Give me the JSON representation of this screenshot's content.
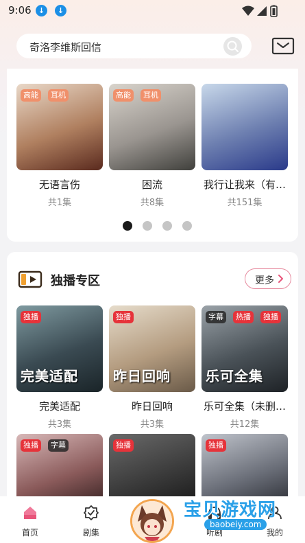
{
  "status_bar": {
    "time": "9:06"
  },
  "search": {
    "text": "奇洛李维斯回信"
  },
  "top_albums": [
    {
      "title": "无语言伤",
      "count": "共1集",
      "tags": [
        "高能",
        "耳机"
      ],
      "colors": [
        "#e9d8c8",
        "#b08060",
        "#5a2a1e"
      ]
    },
    {
      "title": "困流",
      "count": "共8集",
      "tags": [
        "高能",
        "耳机"
      ],
      "colors": [
        "#d9d4cc",
        "#9a9590",
        "#40403c"
      ]
    },
    {
      "title": "我行让我来（有…",
      "count": "共151集",
      "tags": [],
      "colors": [
        "#c8d8ea",
        "#6d7fb0",
        "#2a3a8a"
      ]
    }
  ],
  "carousel": {
    "count": 4,
    "active": 0
  },
  "exclusive": {
    "title": "独播专区",
    "more_label": "更多",
    "albums": [
      {
        "title": "完美适配",
        "count": "共3集",
        "tags": [
          "独播"
        ],
        "cover_text": "完美适配",
        "colors": [
          "#7f9aa0",
          "#3a4a52",
          "#1a2428"
        ]
      },
      {
        "title": "昨日回响",
        "count": "共3集",
        "tags": [
          "独播"
        ],
        "cover_text": "昨日回响",
        "colors": [
          "#e6dccb",
          "#b49c80",
          "#6a5a48"
        ]
      },
      {
        "title": "乐可全集（未删…",
        "count": "共12集",
        "tags": [
          "字幕",
          "热播",
          "独播"
        ],
        "cover_text": "乐可全集",
        "colors": [
          "#9aa2a8",
          "#4a5258",
          "#1e2226"
        ]
      },
      {
        "title": "",
        "count": "",
        "tags": [
          "独播",
          "字幕"
        ],
        "cover_text": "",
        "colors": [
          "#d8b8b8",
          "#8a5a5a",
          "#2a1a1a"
        ]
      },
      {
        "title": "",
        "count": "",
        "tags": [
          "独播"
        ],
        "cover_text": "",
        "colors": [
          "#6a6a6a",
          "#3a3a3a",
          "#141414"
        ]
      },
      {
        "title": "",
        "count": "",
        "tags": [
          "独播"
        ],
        "cover_text": "",
        "colors": [
          "#c0c4cc",
          "#6a6e78",
          "#22242a"
        ]
      }
    ]
  },
  "bottom_nav": {
    "items": [
      {
        "label": "首页",
        "icon": "home-icon",
        "active": true
      },
      {
        "label": "剧集",
        "icon": "drama-icon",
        "active": false
      },
      {
        "label": "",
        "icon": "avatar",
        "active": false
      },
      {
        "label": "听剧",
        "icon": "listen-icon",
        "active": false
      },
      {
        "label": "我的",
        "icon": "profile-icon",
        "active": false
      }
    ]
  },
  "watermark": {
    "text": "宝贝游戏网",
    "url": "baobeiy.com"
  },
  "colors": {
    "accent_pink": "#e8557a",
    "tag_orange": "#f0906b",
    "tag_red": "#e6333a",
    "more_border": "#e68a9e"
  }
}
